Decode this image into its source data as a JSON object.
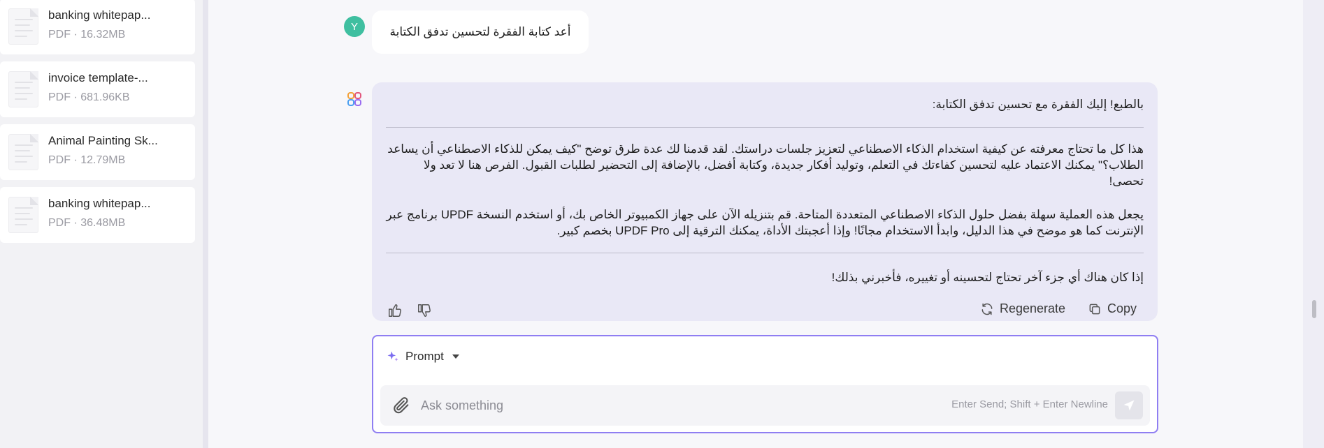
{
  "sidebar": {
    "files": [
      {
        "name": "banking whitepap...",
        "meta": "PDF · 16.32MB"
      },
      {
        "name": "invoice template-...",
        "meta": "PDF · 681.96KB"
      },
      {
        "name": "Animal Painting Sk...",
        "meta": "PDF · 12.79MB"
      },
      {
        "name": "banking whitepap...",
        "meta": "PDF · 36.48MB"
      }
    ]
  },
  "chat": {
    "user_avatar": "Y",
    "user_message": "أعد كتابة الفقرة لتحسين تدفق الكتابة",
    "ai": {
      "intro": "بالطبع! إليك الفقرة مع تحسين تدفق الكتابة:",
      "para1": "هذا كل ما تحتاج معرفته عن كيفية استخدام الذكاء الاصطناعي لتعزيز جلسات دراستك. لقد قدمنا لك عدة طرق توضح \"كيف يمكن للذكاء الاصطناعي أن يساعد الطلاب؟\" يمكنك الاعتماد عليه لتحسين كفاءتك في التعلم، وتوليد أفكار جديدة، وكتابة أفضل، بالإضافة إلى التحضير لطلبات القبول. الفرص هنا لا تعد ولا تحصى!",
      "para2": "يجعل هذه العملية سهلة بفضل حلول الذكاء الاصطناعي المتعددة المتاحة. قم بتنزيله الآن على جهاز الكمبيوتر الخاص بك، أو استخدم النسخة UPDF برنامج عبر الإنترنت كما هو موضح في هذا الدليل، وابدأ الاستخدام مجانًا! وإذا أعجبتك الأداة، يمكنك الترقية إلى UPDF Pro بخصم كبير.",
      "outro": "إذا كان هناك أي جزء آخر تحتاج لتحسينه أو تغييره، فأخبرني بذلك!",
      "regenerate_label": "Regenerate",
      "copy_label": "Copy"
    }
  },
  "input": {
    "prompt_label": "Prompt",
    "placeholder": "Ask something",
    "hint": "Enter Send; Shift + Enter Newline"
  },
  "colors": {
    "accent": "#8f7ef2",
    "ai_bubble": "#e9e8f6",
    "avatar": "#3fbfa0"
  }
}
